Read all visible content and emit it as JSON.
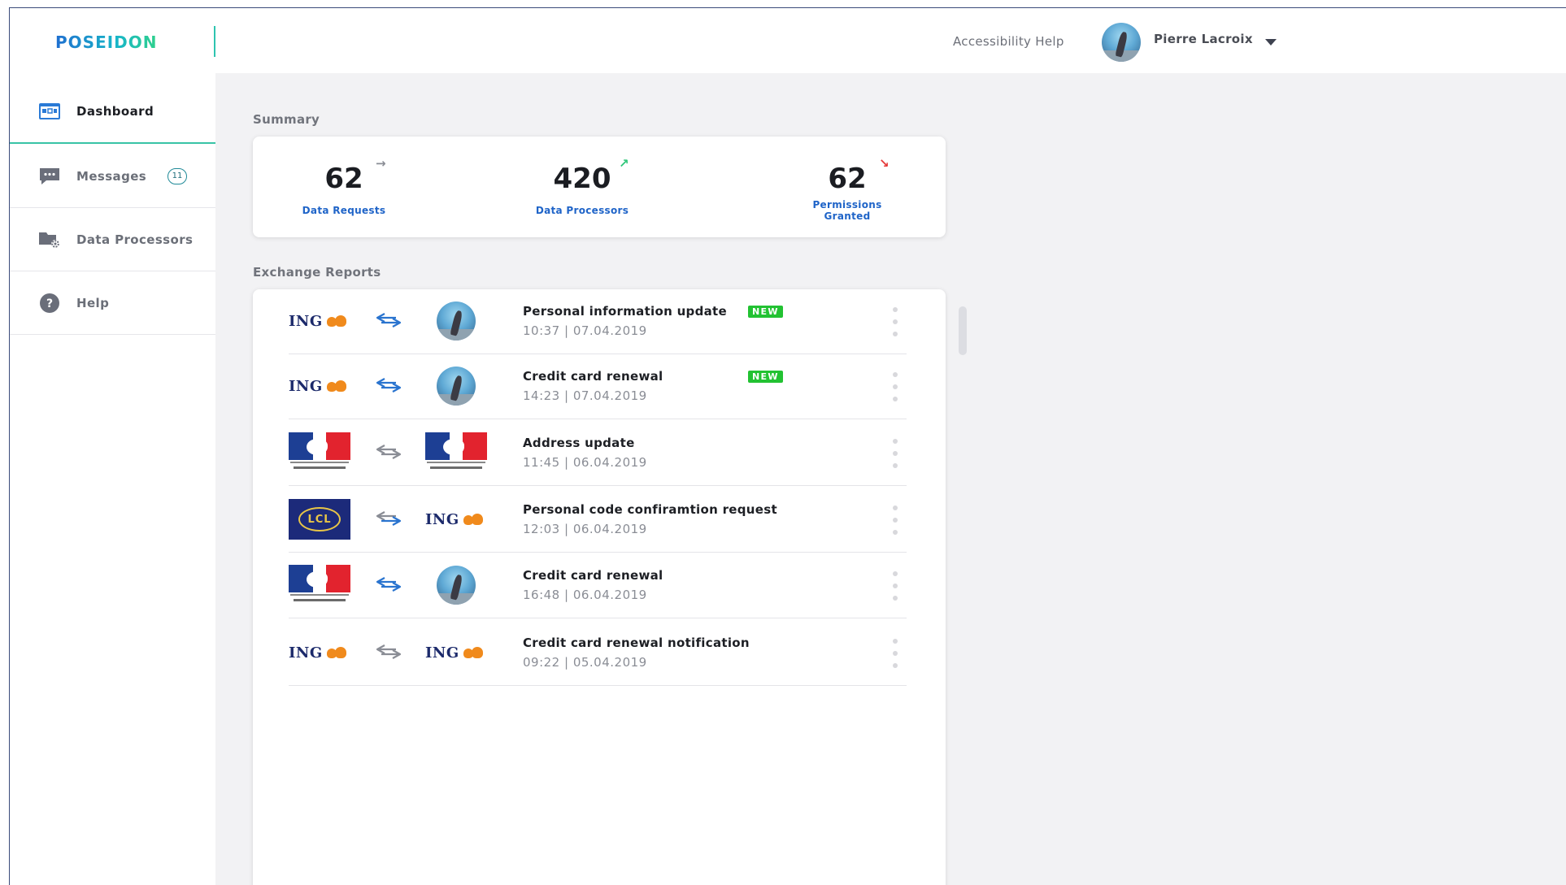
{
  "app": {
    "logo": "POSEIDON"
  },
  "header": {
    "accessibility_help": "Accessibility Help",
    "user_name": "Pierre Lacroix"
  },
  "sidebar": {
    "items": [
      {
        "label": "Dashboard",
        "icon": "dashboard-icon",
        "active": true
      },
      {
        "label": "Messages",
        "icon": "messages-icon",
        "badge": "11"
      },
      {
        "label": "Data Processors",
        "icon": "data-processors-icon"
      },
      {
        "label": "Help",
        "icon": "help-icon"
      }
    ]
  },
  "summary": {
    "title": "Summary",
    "stats": [
      {
        "value": "62",
        "label": "Data Requests",
        "trend": "flat",
        "arrow": "→",
        "color": "#8a8d95"
      },
      {
        "value": "420",
        "label": "Data Processors",
        "trend": "up",
        "arrow": "↗",
        "color": "#2fc77a"
      },
      {
        "value": "62",
        "label_line1": "Permissions",
        "label_line2": "Granted",
        "trend": "down",
        "arrow": "↘",
        "color": "#e53a3a"
      }
    ]
  },
  "exchange_reports": {
    "title": "Exchange Reports",
    "new_label": "NEW",
    "rows": [
      {
        "from": "ING",
        "to": "user",
        "title": "Personal information update",
        "time": "10:37 | 07.04.2019",
        "new": true
      },
      {
        "from": "ING",
        "to": "user",
        "title": "Credit card renewal",
        "time": "14:23 | 07.04.2019",
        "new": true
      },
      {
        "from": "République Française",
        "to": "République Française",
        "title": "Address update",
        "time": "11:45 | 06.04.2019",
        "new": false
      },
      {
        "from": "LCL",
        "to": "ING",
        "title": "Personal code confiramtion request",
        "time": "12:03 | 06.04.2019",
        "new": false
      },
      {
        "from": "République Française",
        "to": "user",
        "title": "Credit card renewal",
        "time": "16:48 | 06.04.2019",
        "new": false
      },
      {
        "from": "ING",
        "to": "ING",
        "title": "Credit card renewal notification",
        "time": "09:22 | 05.04.2019",
        "new": false
      }
    ]
  },
  "logos": {
    "ing_text": "ING",
    "lcl_text": "LCL"
  },
  "colors": {
    "accent": "#38c3a6",
    "link_blue": "#1f64c8",
    "new_green": "#22c232"
  }
}
